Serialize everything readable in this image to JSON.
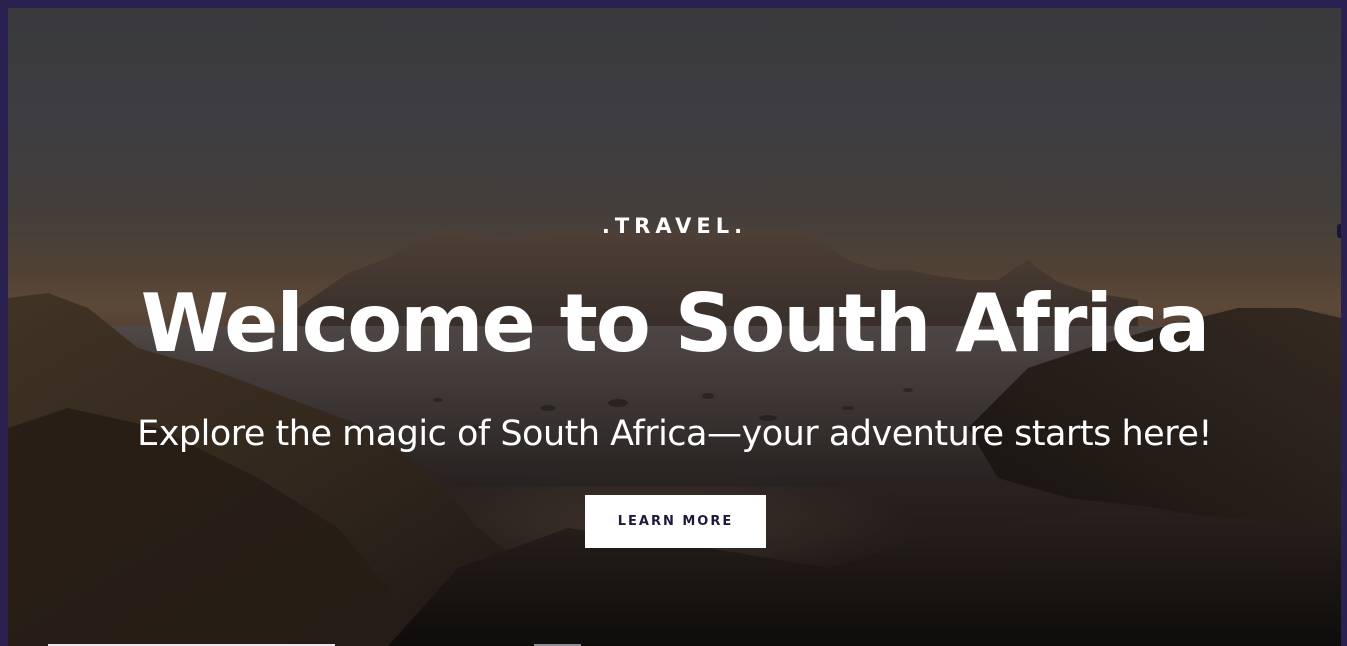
{
  "hero": {
    "kicker": ".TRAVEL.",
    "title": "Welcome to South Africa",
    "subtitle": "Explore the magic of South Africa—your adventure starts here!",
    "cta_label": "LEARN MORE",
    "background_image": "table-mountain-beach-dusk"
  },
  "colors": {
    "frame": "#2b2150",
    "button_bg": "#ffffff",
    "button_text": "#1f1a3d",
    "text": "#ffffff"
  }
}
